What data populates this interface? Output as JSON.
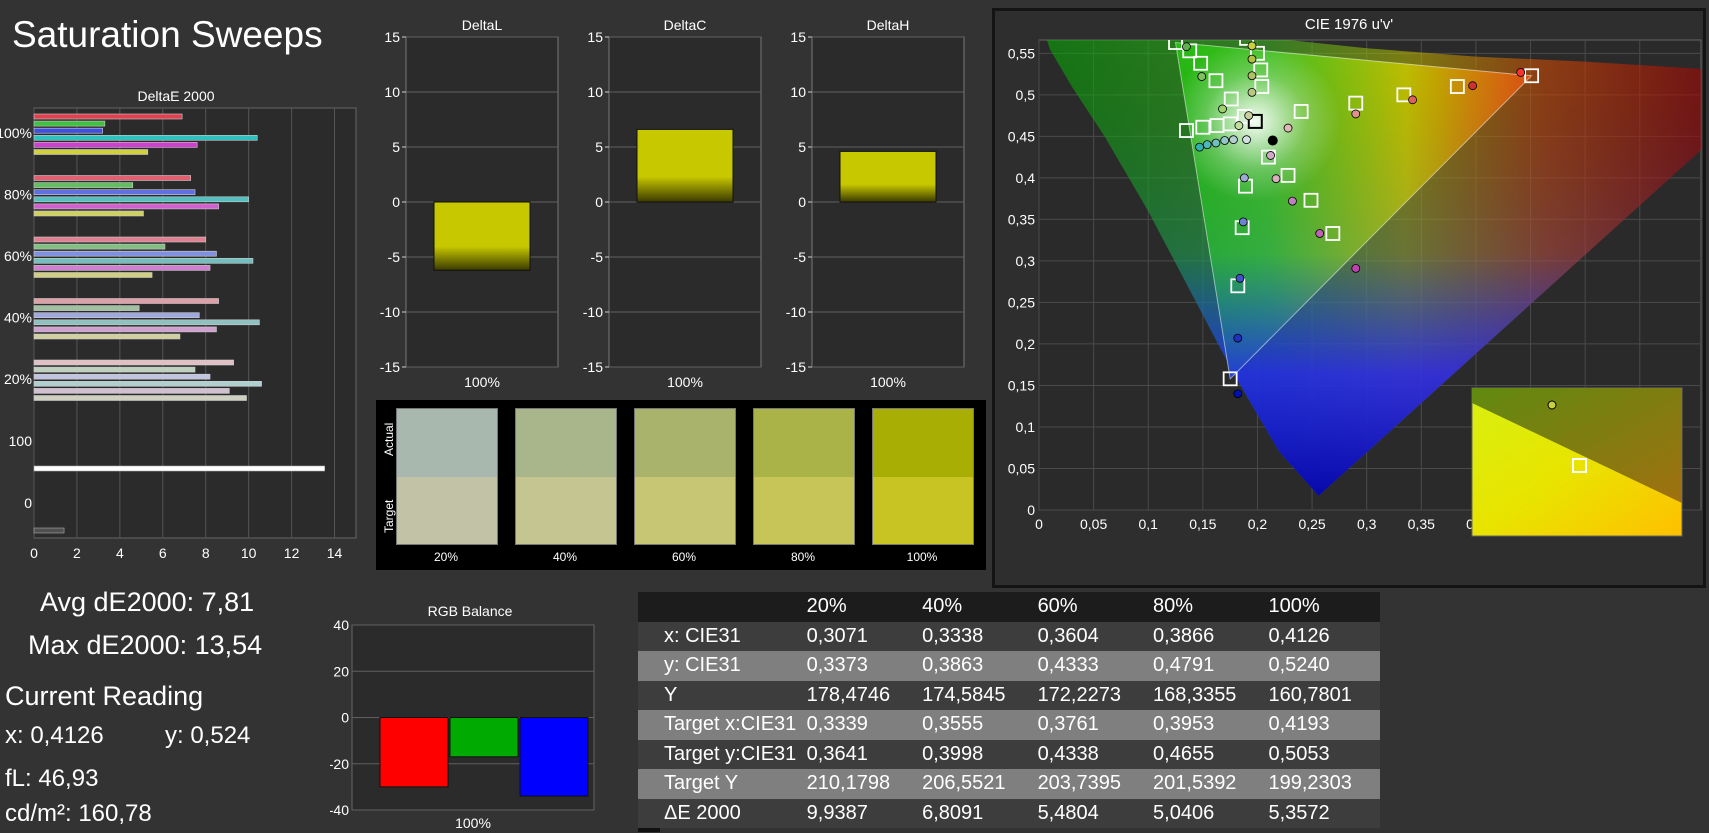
{
  "page": {
    "title": "Saturation Sweeps"
  },
  "stats": {
    "avg": "Avg dE2000: 7,81",
    "max": "Max dE2000: 13,54",
    "current_reading": "Current Reading",
    "x": "x: 0,4126",
    "y": "y: 0,524",
    "fl": "fL: 46,93",
    "cdm2": "cd/m²: 160,78"
  },
  "swatches": {
    "actual_label": "Actual",
    "target_label": "Target",
    "items": [
      {
        "label": "20%",
        "actual": "#a9b8ae",
        "target": "#c2c2a6"
      },
      {
        "label": "40%",
        "actual": "#a9b68c",
        "target": "#c5c591"
      },
      {
        "label": "60%",
        "actual": "#a9b36b",
        "target": "#c7c674"
      },
      {
        "label": "80%",
        "actual": "#a9b347",
        "target": "#c7c557"
      },
      {
        "label": "100%",
        "actual": "#a9ae05",
        "target": "#c7c423"
      }
    ]
  },
  "table": {
    "columns": [
      "",
      "20%",
      "40%",
      "60%",
      "80%",
      "100%"
    ],
    "rows": [
      {
        "label": "x: CIE31",
        "values": [
          "0,3071",
          "0,3338",
          "0,3604",
          "0,3866",
          "0,4126"
        ]
      },
      {
        "label": "y: CIE31",
        "values": [
          "0,3373",
          "0,3863",
          "0,4333",
          "0,4791",
          "0,5240"
        ]
      },
      {
        "label": "Y",
        "values": [
          "178,4746",
          "174,5845",
          "172,2273",
          "168,3355",
          "160,7801"
        ]
      },
      {
        "label": "Target x:CIE31",
        "values": [
          "0,3339",
          "0,3555",
          "0,3761",
          "0,3953",
          "0,4193"
        ]
      },
      {
        "label": "Target y:CIE31",
        "values": [
          "0,3641",
          "0,3998",
          "0,4338",
          "0,4655",
          "0,5053"
        ]
      },
      {
        "label": "Target Y",
        "values": [
          "210,1798",
          "206,5521",
          "203,7395",
          "201,5392",
          "199,2303"
        ]
      },
      {
        "label": "ΔE 2000",
        "values": [
          "9,9387",
          "6,8091",
          "5,4804",
          "5,0406",
          "5,3572"
        ]
      }
    ]
  },
  "chart_data": [
    {
      "type": "bar",
      "title": "DeltaE 2000",
      "orientation": "horizontal",
      "xlim": [
        0,
        15
      ],
      "x_ticks": [
        "0",
        "2",
        "4",
        "6",
        "8",
        "10",
        "12",
        "14"
      ],
      "y_labels": [
        "100%",
        "80%",
        "60%",
        "40%",
        "20%",
        "100",
        "0"
      ],
      "groups": [
        {
          "label": "100%",
          "values": [
            6.9,
            3.3,
            3.2,
            10.4,
            7.6,
            5.3
          ],
          "colors": [
            "#e04050",
            "#40c040",
            "#4050e0",
            "#30c0c0",
            "#d040d0",
            "#d0d040"
          ]
        },
        {
          "label": "80%",
          "values": [
            7.3,
            4.6,
            7.5,
            10.0,
            8.6,
            5.1
          ],
          "colors": [
            "#e06070",
            "#60c060",
            "#6070e0",
            "#50c0c0",
            "#d060d0",
            "#d0d060"
          ]
        },
        {
          "label": "60%",
          "values": [
            8.0,
            6.1,
            8.5,
            10.2,
            8.2,
            5.5
          ],
          "colors": [
            "#e08090",
            "#80c080",
            "#8090e0",
            "#70c0c0",
            "#d080d0",
            "#d0d080"
          ]
        },
        {
          "label": "40%",
          "values": [
            8.6,
            4.9,
            7.7,
            10.5,
            8.5,
            6.8
          ],
          "colors": [
            "#e0a0a8",
            "#a0c0a0",
            "#a0a8e0",
            "#90c0c0",
            "#d0a0d0",
            "#d0d0a0"
          ]
        },
        {
          "label": "20%",
          "values": [
            9.3,
            7.5,
            8.2,
            10.6,
            9.1,
            9.9
          ],
          "colors": [
            "#e0c0c4",
            "#c0d0c0",
            "#c0c4e0",
            "#b0d0d0",
            "#d0c0d0",
            "#d0d0c0"
          ]
        }
      ],
      "extra_bars": [
        {
          "label": "100",
          "value": 13.54,
          "color": "#ffffff"
        },
        {
          "label": "0",
          "value": 1.4,
          "color": "#505050"
        }
      ]
    },
    {
      "type": "bar",
      "title": "DeltaL",
      "categories": [
        "100%"
      ],
      "values": [
        -6.2
      ],
      "ylim": [
        -15,
        15
      ],
      "y_ticks": [
        "15",
        "10",
        "5",
        "0",
        "-5",
        "-10",
        "-15"
      ],
      "color": "#c8c800"
    },
    {
      "type": "bar",
      "title": "DeltaC",
      "categories": [
        "100%"
      ],
      "values": [
        6.6
      ],
      "ylim": [
        -15,
        15
      ],
      "y_ticks": [
        "15",
        "10",
        "5",
        "0",
        "-5",
        "-10",
        "-15"
      ],
      "color": "#c8c800"
    },
    {
      "type": "bar",
      "title": "DeltaH",
      "categories": [
        "100%"
      ],
      "values": [
        4.6
      ],
      "ylim": [
        -15,
        15
      ],
      "y_ticks": [
        "15",
        "10",
        "5",
        "0",
        "-5",
        "-10",
        "-15"
      ],
      "color": "#c8c800"
    },
    {
      "type": "bar",
      "title": "RGB Balance",
      "categories": [
        "100%"
      ],
      "series": [
        {
          "color": "#ff0000",
          "values": [
            -30
          ]
        },
        {
          "color": "#00aa00",
          "values": [
            -17
          ]
        },
        {
          "color": "#0000ff",
          "values": [
            -34
          ]
        }
      ],
      "ylim": [
        -40,
        40
      ],
      "y_ticks": [
        "40",
        "20",
        "0",
        "-20",
        "-40"
      ]
    },
    {
      "type": "scatter",
      "title": "CIE 1976 u'v'",
      "xlim": [
        0,
        0.6
      ],
      "ylim": [
        0,
        0.6
      ],
      "x_ticks": [
        "0",
        "0,05",
        "0,1",
        "0,15",
        "0,2",
        "0,25",
        "0,3",
        "0,35",
        "0,4",
        "0,45",
        "0,5",
        "0,55"
      ],
      "y_ticks": [
        "0",
        "0,05",
        "0,1",
        "0,15",
        "0,2",
        "0,25",
        "0,3",
        "0,35",
        "0,4",
        "0,45",
        "0,5",
        "0,55"
      ],
      "gamut_triangle": [
        [
          0.451,
          0.523
        ],
        [
          0.125,
          0.563
        ],
        [
          0.175,
          0.158
        ]
      ],
      "white_point": [
        0.198,
        0.468
      ],
      "targets": [
        [
          0.125,
          0.563
        ],
        [
          0.138,
          0.553
        ],
        [
          0.148,
          0.538
        ],
        [
          0.162,
          0.517
        ],
        [
          0.176,
          0.495
        ],
        [
          0.188,
          0.474
        ],
        [
          0.135,
          0.457
        ],
        [
          0.15,
          0.461
        ],
        [
          0.163,
          0.463
        ],
        [
          0.175,
          0.465
        ],
        [
          0.19,
          0.568
        ],
        [
          0.2,
          0.55
        ],
        [
          0.203,
          0.53
        ],
        [
          0.204,
          0.51
        ],
        [
          0.189,
          0.39
        ],
        [
          0.186,
          0.34
        ],
        [
          0.182,
          0.27
        ],
        [
          0.175,
          0.158
        ],
        [
          0.21,
          0.425
        ],
        [
          0.228,
          0.403
        ],
        [
          0.249,
          0.373
        ],
        [
          0.269,
          0.333
        ],
        [
          0.24,
          0.48
        ],
        [
          0.29,
          0.49
        ],
        [
          0.334,
          0.5
        ],
        [
          0.383,
          0.51
        ],
        [
          0.451,
          0.523
        ]
      ],
      "measured": [
        {
          "uv": [
            0.135,
            0.558
          ],
          "color": "#60b050"
        },
        {
          "uv": [
            0.149,
            0.522
          ],
          "color": "#80c060"
        },
        {
          "uv": [
            0.168,
            0.483
          ],
          "color": "#a0d070"
        },
        {
          "uv": [
            0.183,
            0.463
          ],
          "color": "#c0e0a0"
        },
        {
          "uv": [
            0.195,
            0.559
          ],
          "color": "#c8d040"
        },
        {
          "uv": [
            0.195,
            0.543
          ],
          "color": "#b0c040"
        },
        {
          "uv": [
            0.195,
            0.523
          ],
          "color": "#b0c060"
        },
        {
          "uv": [
            0.195,
            0.503
          ],
          "color": "#b8c880"
        },
        {
          "uv": [
            0.192,
            0.475
          ],
          "color": "#c8d0a0"
        },
        {
          "uv": [
            0.147,
            0.437
          ],
          "color": "#30b0b0"
        },
        {
          "uv": [
            0.154,
            0.44
          ],
          "color": "#50b8b8"
        },
        {
          "uv": [
            0.162,
            0.442
          ],
          "color": "#70c0c0"
        },
        {
          "uv": [
            0.17,
            0.445
          ],
          "color": "#90c8c8"
        },
        {
          "uv": [
            0.178,
            0.446
          ],
          "color": "#b0d0d0"
        },
        {
          "uv": [
            0.19,
            0.446
          ],
          "color": "#d0e0e0"
        },
        {
          "uv": [
            0.188,
            0.4
          ],
          "color": "#a0a8d8"
        },
        {
          "uv": [
            0.187,
            0.347
          ],
          "color": "#7080d0"
        },
        {
          "uv": [
            0.184,
            0.279
          ],
          "color": "#4050c8"
        },
        {
          "uv": [
            0.182,
            0.207
          ],
          "color": "#2030c0"
        },
        {
          "uv": [
            0.182,
            0.14
          ],
          "color": "#0010b0"
        },
        {
          "uv": [
            0.212,
            0.427
          ],
          "color": "#d0a8c8"
        },
        {
          "uv": [
            0.232,
            0.372
          ],
          "color": "#c080c0"
        },
        {
          "uv": [
            0.257,
            0.333
          ],
          "color": "#c060b8"
        },
        {
          "uv": [
            0.29,
            0.291
          ],
          "color": "#c040b0"
        },
        {
          "uv": [
            0.217,
            0.399
          ],
          "color": "#d8b0c0"
        },
        {
          "uv": [
            0.228,
            0.46
          ],
          "color": "#e0b8b8"
        },
        {
          "uv": [
            0.29,
            0.477
          ],
          "color": "#e09090"
        },
        {
          "uv": [
            0.342,
            0.494
          ],
          "color": "#e06060"
        },
        {
          "uv": [
            0.397,
            0.511
          ],
          "color": "#d03030"
        },
        {
          "uv": [
            0.441,
            0.527
          ],
          "color": "#ff3030"
        }
      ],
      "current_point": [
        0.214,
        0.445
      ]
    }
  ]
}
